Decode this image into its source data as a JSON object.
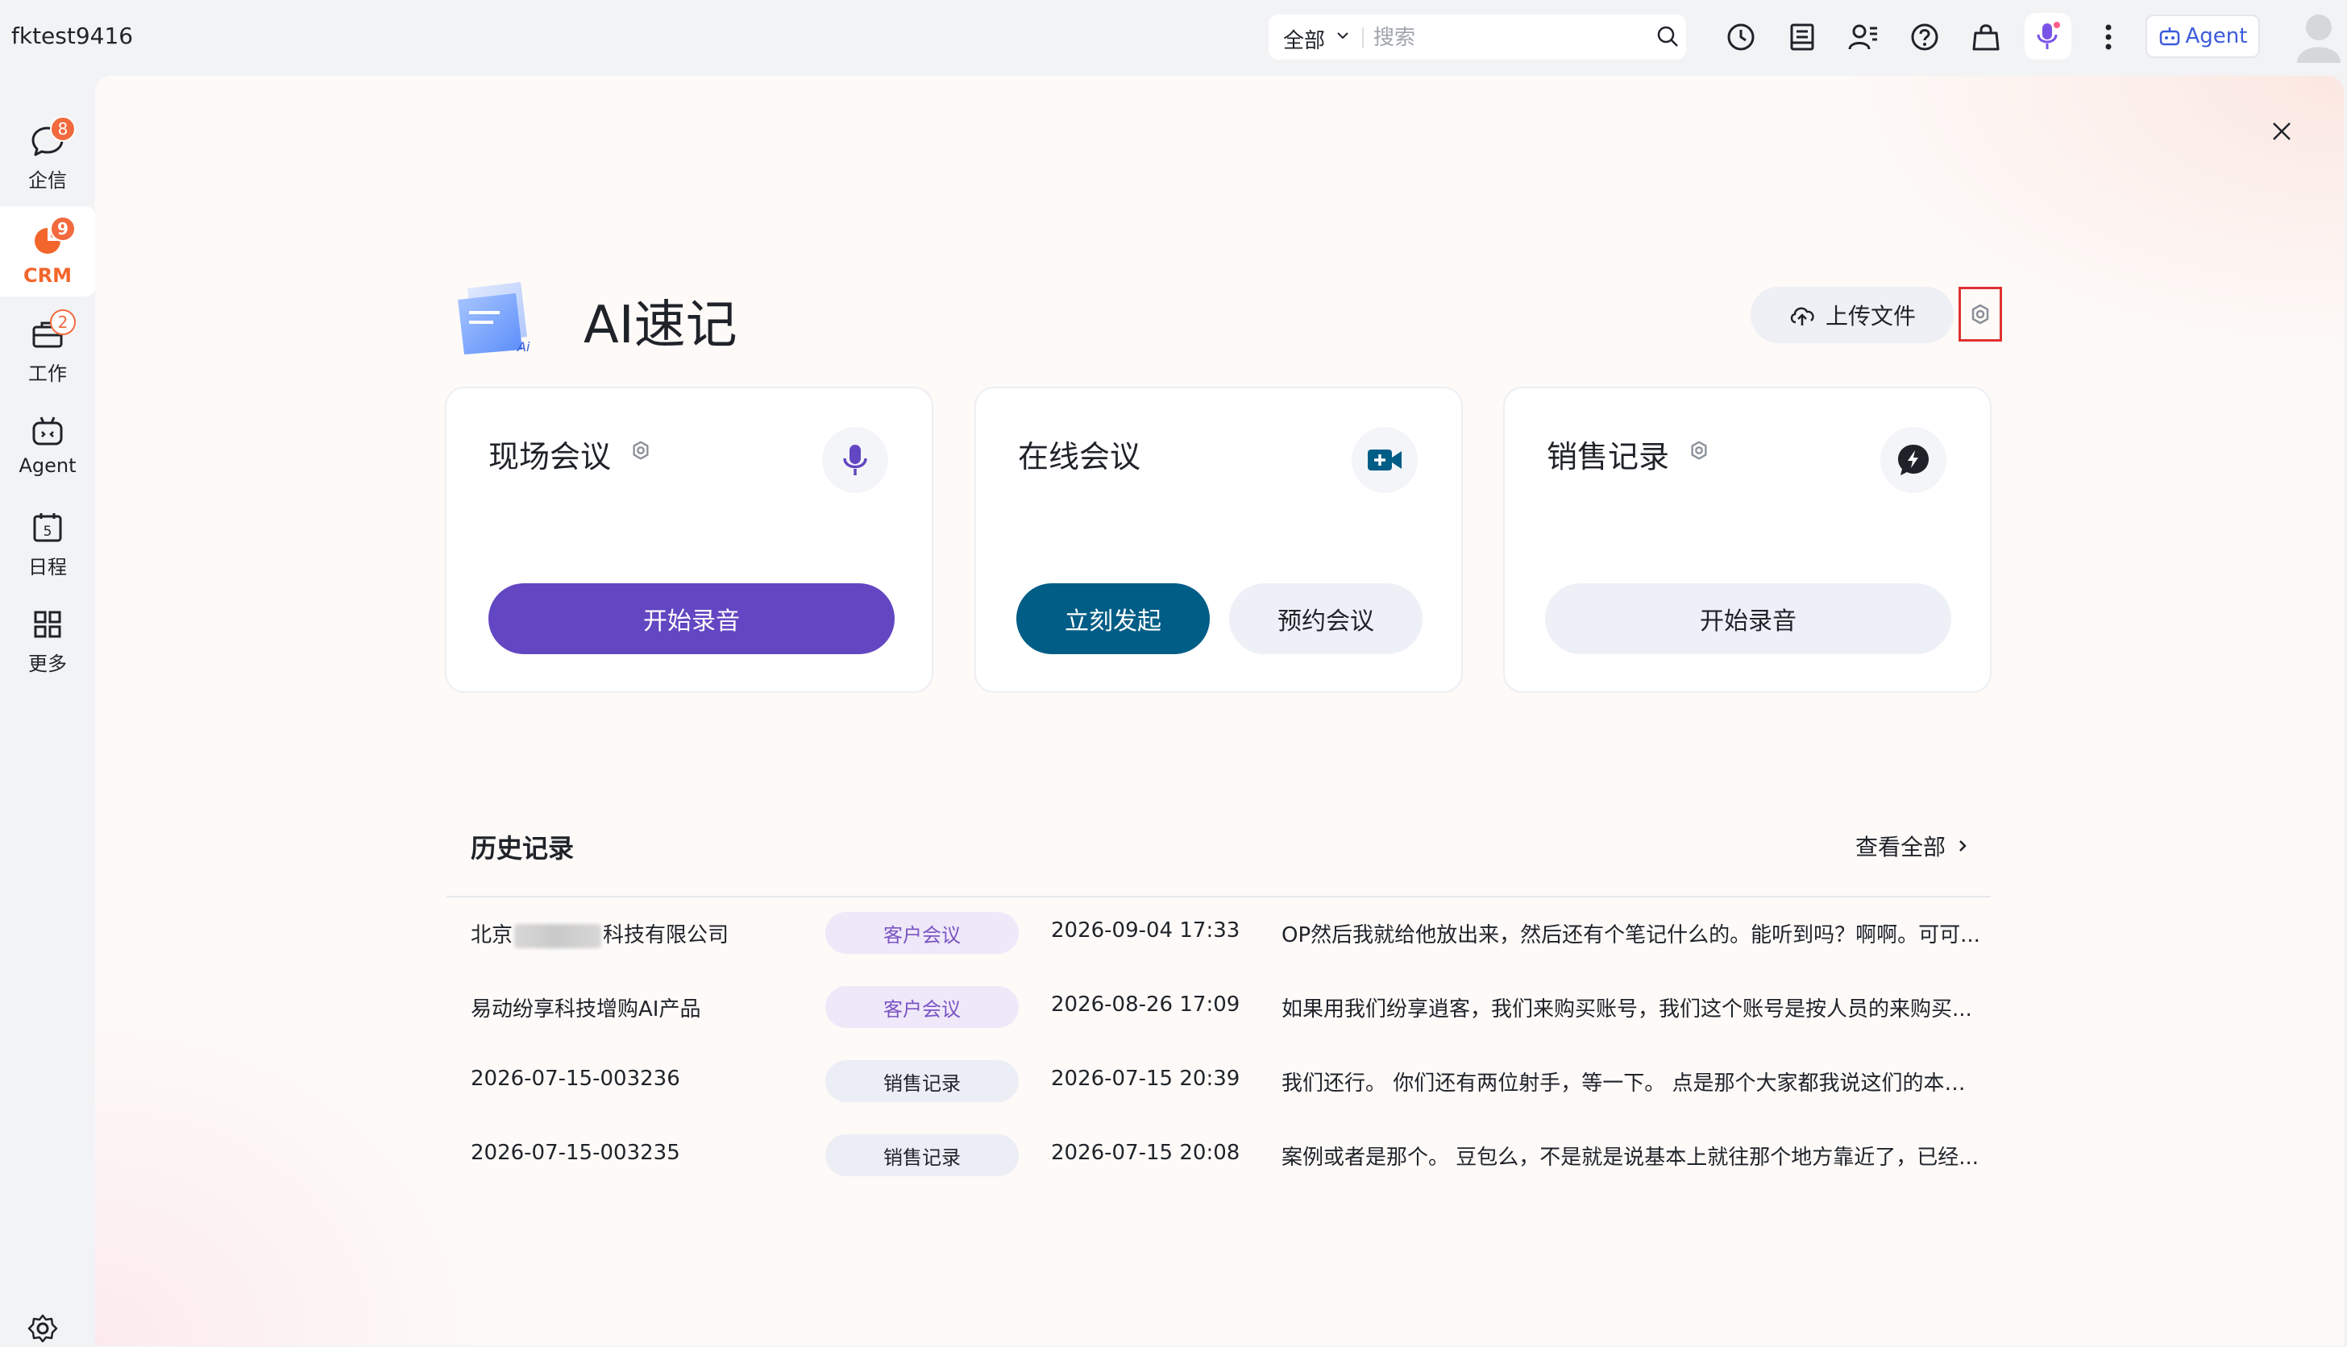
{
  "header": {
    "user_name": "fktest9416",
    "search": {
      "scope": "全部",
      "placeholder": "搜索"
    },
    "agent_label": "Agent"
  },
  "sidebar": {
    "items": [
      {
        "label": "企信",
        "badge": "8",
        "icon": "chat-bubble-icon"
      },
      {
        "label": "CRM",
        "badge": "9",
        "icon": "crm-pie-icon",
        "active": true
      },
      {
        "label": "工作",
        "badge": "2",
        "icon": "briefcase-icon"
      },
      {
        "label": "Agent",
        "badge": "",
        "icon": "robot-icon"
      },
      {
        "label": "日程",
        "badge": "",
        "icon": "calendar-icon",
        "calendar_day": "5"
      },
      {
        "label": "更多",
        "badge": "",
        "icon": "grid-icon"
      }
    ]
  },
  "main": {
    "title": "AI速记",
    "logo_mark": "Ai",
    "upload_label": "上传文件",
    "cards": [
      {
        "title": "现场会议",
        "buttons": [
          "开始录音"
        ]
      },
      {
        "title": "在线会议",
        "buttons": [
          "立刻发起",
          "预约会议"
        ]
      },
      {
        "title": "销售记录",
        "buttons": [
          "开始录音"
        ]
      }
    ],
    "history": {
      "title": "历史记录",
      "view_all": "查看全部",
      "rows": [
        {
          "name_prefix": "北京",
          "name_suffix": "科技有限公司",
          "tag": "客户会议",
          "time": "2026-09-04 17:33",
          "snippet": "OP然后我就给他放出来，然后还有个笔记什么的。能听到吗？啊啊。可可..."
        },
        {
          "name": "易动纷享科技增购AI产品",
          "tag": "客户会议",
          "time": "2026-08-26 17:09",
          "snippet": "如果用我们纷享逍客，我们来购买账号，我们这个账号是按人员的来购买..."
        },
        {
          "name": "2026-07-15-003236",
          "tag": "销售记录",
          "time": "2026-07-15 20:39",
          "snippet": "我们还行。 你们还有两位射手，等一下。 点是那个大家都我说这们的本次..."
        },
        {
          "name": "2026-07-15-003235",
          "tag": "销售记录",
          "time": "2026-07-15 20:08",
          "snippet": "案例或者是那个。 豆包么，不是就是说基本上就往那个地方靠近了，已经..."
        }
      ]
    }
  },
  "colors": {
    "accent_orange": "#f2662b",
    "primary_purple": "#6346c2",
    "online_teal": "#005d86",
    "badge_red": "#f26a3e",
    "highlight_red": "#e03131"
  }
}
